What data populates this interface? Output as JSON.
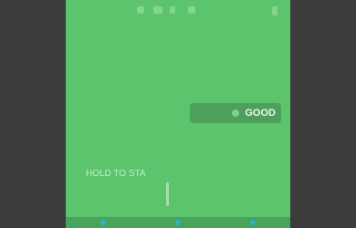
{
  "pill": {
    "label": "GOOD"
  },
  "overlay": {
    "handle_label": "HOLD TO STA"
  },
  "icons": [
    "battery-icon",
    "signal-icon",
    "wifi-icon",
    "clock-icon",
    "menu-icon"
  ]
}
